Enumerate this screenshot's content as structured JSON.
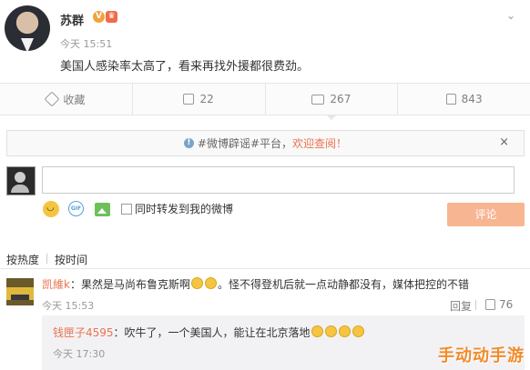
{
  "post": {
    "username": "苏群",
    "verified_badge": "V",
    "member_badge": "♛",
    "time": "今天 15:51",
    "text": "美国人感染率太高了，看来再找外援都很费劲。",
    "menu_icon": "chevron-down-icon"
  },
  "actions": [
    {
      "icon": "star-icon",
      "label": "收藏"
    },
    {
      "icon": "forward-icon",
      "label": "22"
    },
    {
      "icon": "comment-icon",
      "label": "267"
    },
    {
      "icon": "like-icon",
      "label": "843"
    }
  ],
  "notice": {
    "icon": "info-icon",
    "main": "#微博辟谣#平台，",
    "link": "欢迎查阅！",
    "close": "×"
  },
  "compose": {
    "placeholder": "",
    "checkbox_label": "同时转发到我的微博",
    "submit": "评论",
    "gif_label": "GIF"
  },
  "sort": {
    "hot": "按热度",
    "time": "按时间"
  },
  "comment": {
    "name": "凯維k",
    "text_a": "：果然是马尚布鲁克斯啊",
    "text_b": "。怪不得登机后就一点动静都没有，媒体把控的不错",
    "time": "今天 15:53",
    "reply": "回复",
    "likes": "76"
  },
  "reply": {
    "name": "钱匣子4595",
    "text": "：吹牛了，一个美国人，能让在北京落地",
    "time": "今天 17:30"
  },
  "watermark": "手动动手游"
}
